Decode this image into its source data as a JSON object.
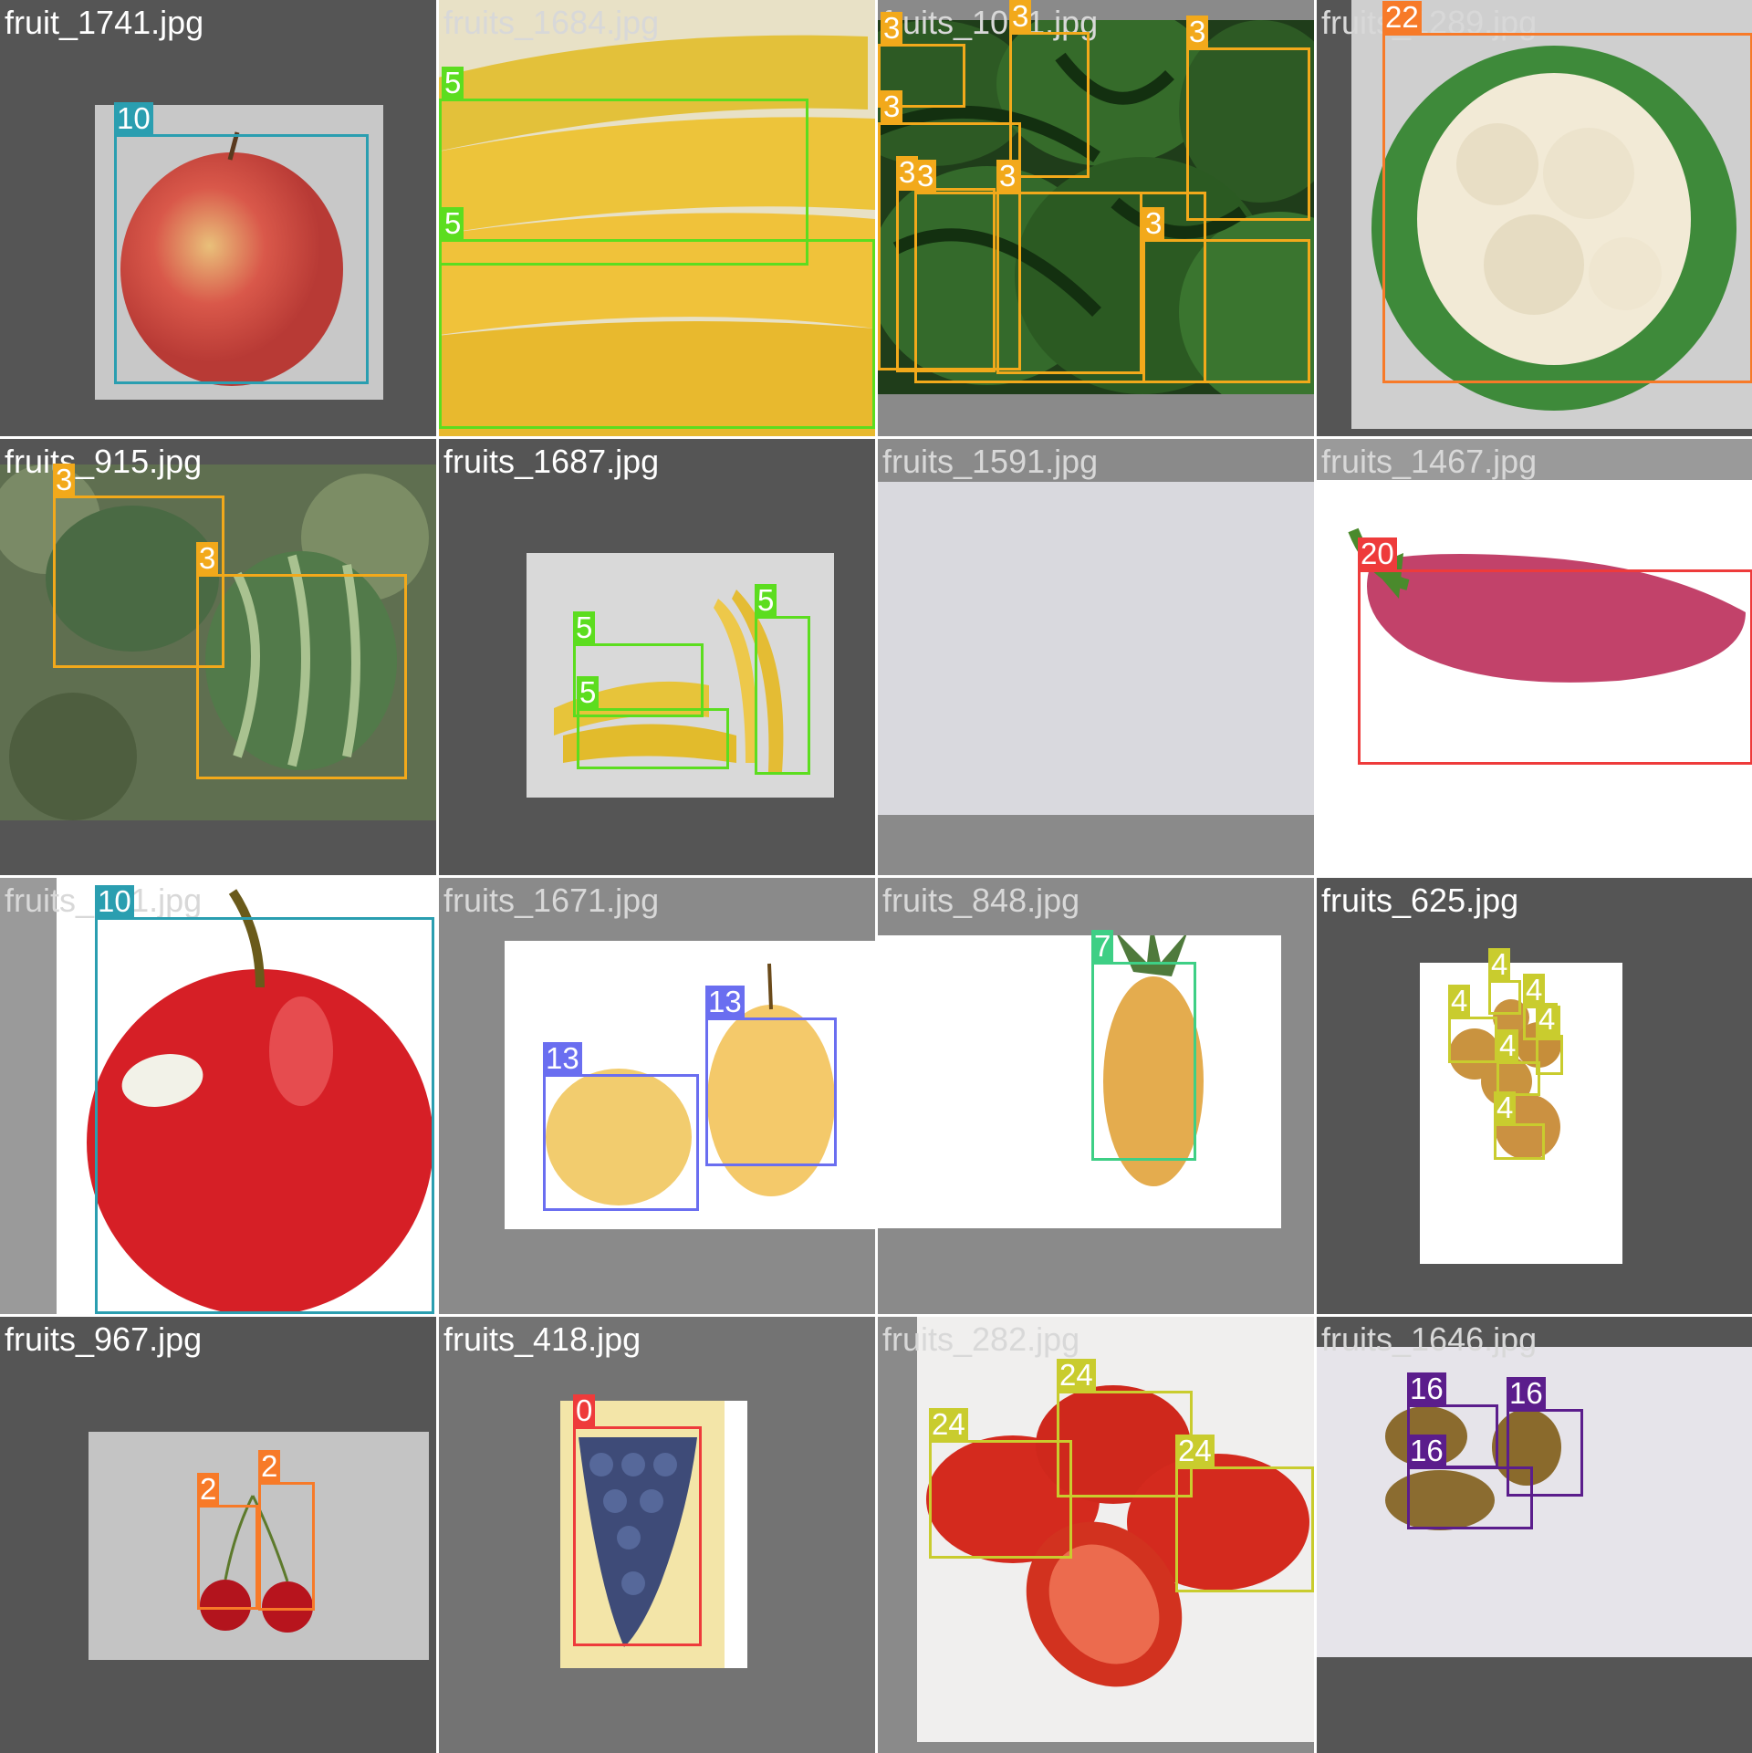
{
  "tiles": [
    {
      "file": "fruit_1741.jpg",
      "content": "apple",
      "boxes": [
        {
          "label": "10",
          "color": "#2a9eb0"
        }
      ]
    },
    {
      "file": "fruits_1684.jpg",
      "content": "bananas",
      "boxes": [
        {
          "label": "5",
          "color": "#5cdd1f"
        },
        {
          "label": "5",
          "color": "#5cdd1f"
        }
      ]
    },
    {
      "file": "fruits_1041.jpg",
      "content": "watermelons",
      "boxes": [
        {
          "label": "3",
          "color": "#f2a91b"
        },
        {
          "label": "3",
          "color": "#f2a91b"
        },
        {
          "label": "3",
          "color": "#f2a91b"
        },
        {
          "label": "3",
          "color": "#f2a91b"
        },
        {
          "label": "3",
          "color": "#f2a91b"
        },
        {
          "label": "3",
          "color": "#f2a91b"
        },
        {
          "label": "3",
          "color": "#f2a91b"
        },
        {
          "label": "3",
          "color": "#f2a91b"
        }
      ]
    },
    {
      "file": "fruits_1289.jpg",
      "content": "cauliflower",
      "boxes": [
        {
          "label": "22",
          "color": "#f77a28"
        }
      ]
    },
    {
      "file": "fruits_915.jpg",
      "content": "watermelons in field",
      "boxes": [
        {
          "label": "3",
          "color": "#f2a91b"
        },
        {
          "label": "3",
          "color": "#f2a91b"
        }
      ]
    },
    {
      "file": "fruits_1687.jpg",
      "content": "bananas",
      "boxes": [
        {
          "label": "5",
          "color": "#5cdd1f"
        },
        {
          "label": "5",
          "color": "#5cdd1f"
        },
        {
          "label": "5",
          "color": "#5cdd1f"
        }
      ]
    },
    {
      "file": "fruits_1591.jpg",
      "content": "blank",
      "boxes": []
    },
    {
      "file": "fruits_1467.jpg",
      "content": "pink pepper",
      "boxes": [
        {
          "label": "20",
          "color": "#ee3b3b"
        }
      ]
    },
    {
      "file": "fruits_1?1.jpg",
      "content": "red apple",
      "boxes": [
        {
          "label": "10",
          "color": "#2a9eb0"
        }
      ]
    },
    {
      "file": "fruits_1671.jpg",
      "content": "pears",
      "boxes": [
        {
          "label": "13",
          "color": "#6a6ef0"
        },
        {
          "label": "13",
          "color": "#6a6ef0"
        }
      ]
    },
    {
      "file": "fruits_848.jpg",
      "content": "pineapple",
      "boxes": [
        {
          "label": "7",
          "color": "#3ecf85"
        }
      ]
    },
    {
      "file": "fruits_625.jpg",
      "content": "longans",
      "boxes": [
        {
          "label": "4",
          "color": "#c9cc2e"
        },
        {
          "label": "4",
          "color": "#c9cc2e"
        },
        {
          "label": "4",
          "color": "#c9cc2e"
        },
        {
          "label": "4",
          "color": "#c9cc2e"
        },
        {
          "label": "4",
          "color": "#c9cc2e"
        },
        {
          "label": "4",
          "color": "#c9cc2e"
        }
      ]
    },
    {
      "file": "fruits_967.jpg",
      "content": "cherries",
      "boxes": [
        {
          "label": "2",
          "color": "#f77a28"
        },
        {
          "label": "2",
          "color": "#f77a28"
        }
      ]
    },
    {
      "file": "fruits_418.jpg",
      "content": "grapes",
      "boxes": [
        {
          "label": "0",
          "color": "#ee3b3b"
        }
      ]
    },
    {
      "file": "fruits_282.jpg",
      "content": "tomatoes",
      "boxes": [
        {
          "label": "24",
          "color": "#c9cc2e"
        },
        {
          "label": "24",
          "color": "#c9cc2e"
        },
        {
          "label": "24",
          "color": "#c9cc2e"
        }
      ]
    },
    {
      "file": "fruits_1646.jpg",
      "content": "kiwis",
      "boxes": [
        {
          "label": "16",
          "color": "#5b1d8c"
        },
        {
          "label": "16",
          "color": "#5b1d8c"
        },
        {
          "label": "16",
          "color": "#5b1d8c"
        }
      ]
    }
  ]
}
